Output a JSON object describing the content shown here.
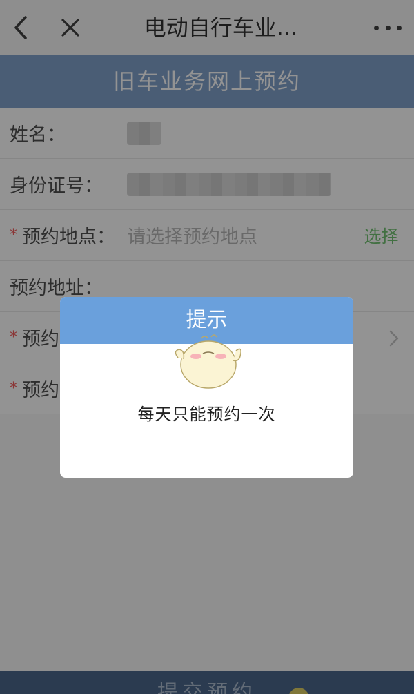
{
  "nav": {
    "title": "电动自行车业...",
    "back_icon": "chevron-left-icon",
    "close_icon": "close-icon",
    "more_icon": "more-dots-icon"
  },
  "page_header": {
    "title": "旧车业务网上预约"
  },
  "form": {
    "name_label": "姓名：",
    "id_label": "身份证号：",
    "location_required": "*",
    "location_label": "预约地点：",
    "location_placeholder": "请选择预约地点",
    "location_select": "选择",
    "address_label": "预约地址：",
    "row5_required": "*",
    "row5_label": "预约",
    "row6_required": "*",
    "row6_label": "预约"
  },
  "dialog": {
    "title": "提示",
    "message": "每天只能预约一次"
  },
  "submit": {
    "label": "提交预约"
  },
  "colors": {
    "header_blue": "#6d93c3",
    "dialog_header": "#6aa0dc",
    "select_green": "#5cb85c",
    "required_red": "#e44444"
  }
}
